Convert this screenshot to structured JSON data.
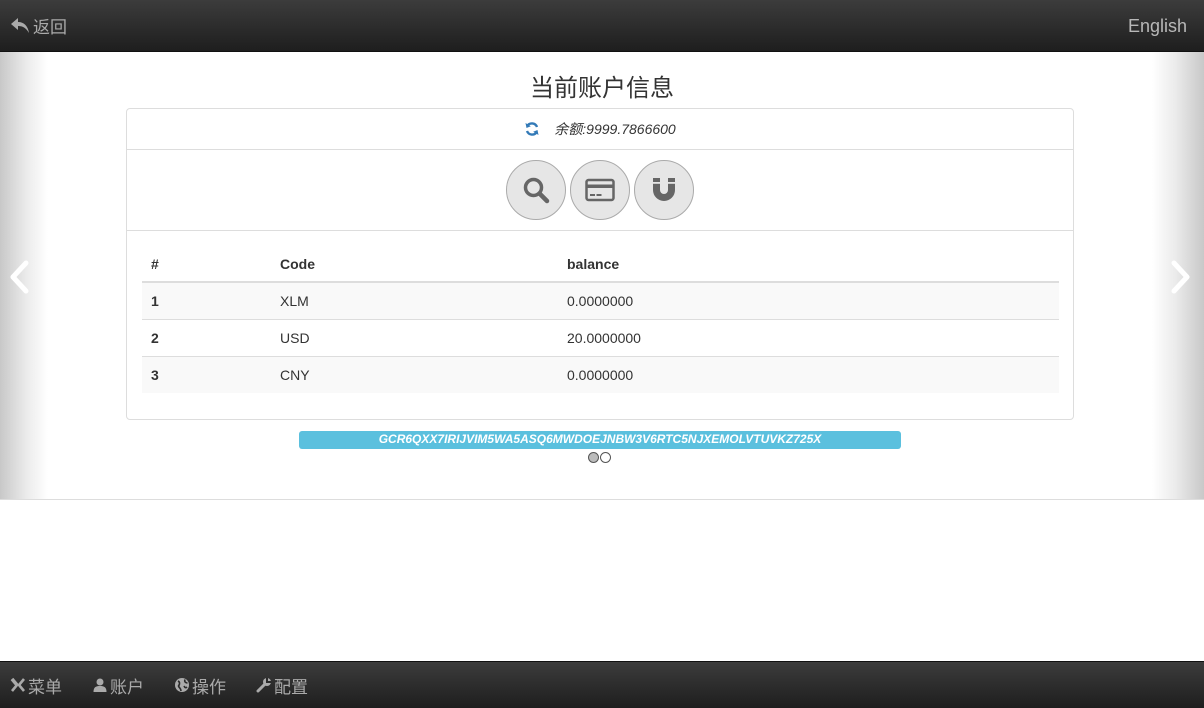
{
  "header": {
    "back_label": "返回",
    "language_label": "English"
  },
  "main": {
    "title": "当前账户信息",
    "balance_label": "余额:",
    "balance_value": "9999.7866600",
    "actions": [
      {
        "icon": "search-icon"
      },
      {
        "icon": "credit-card-icon"
      },
      {
        "icon": "magnet-icon"
      }
    ],
    "table": {
      "headers": [
        "#",
        "Code",
        "balance"
      ],
      "rows": [
        {
          "index": "1",
          "code": "XLM",
          "balance": "0.0000000"
        },
        {
          "index": "2",
          "code": "USD",
          "balance": "20.0000000"
        },
        {
          "index": "3",
          "code": "CNY",
          "balance": "0.0000000"
        }
      ]
    },
    "address": "GCR6QXX7IRIJVIM5WA5ASQ6MWDOEJNBW3V6RTC5NJXEMOLVTUVKZ725X",
    "carousel_active_index": 0
  },
  "footer": {
    "items": [
      {
        "label": "菜单",
        "icon": "menu-x-icon"
      },
      {
        "label": "账户",
        "icon": "user-icon"
      },
      {
        "label": "操作",
        "icon": "globe-icon"
      },
      {
        "label": "配置",
        "icon": "wrench-icon"
      }
    ]
  },
  "colors": {
    "bar_dark": "#2a2a2a",
    "address_bg": "#5bc0de",
    "refresh_icon": "#337ab7"
  }
}
